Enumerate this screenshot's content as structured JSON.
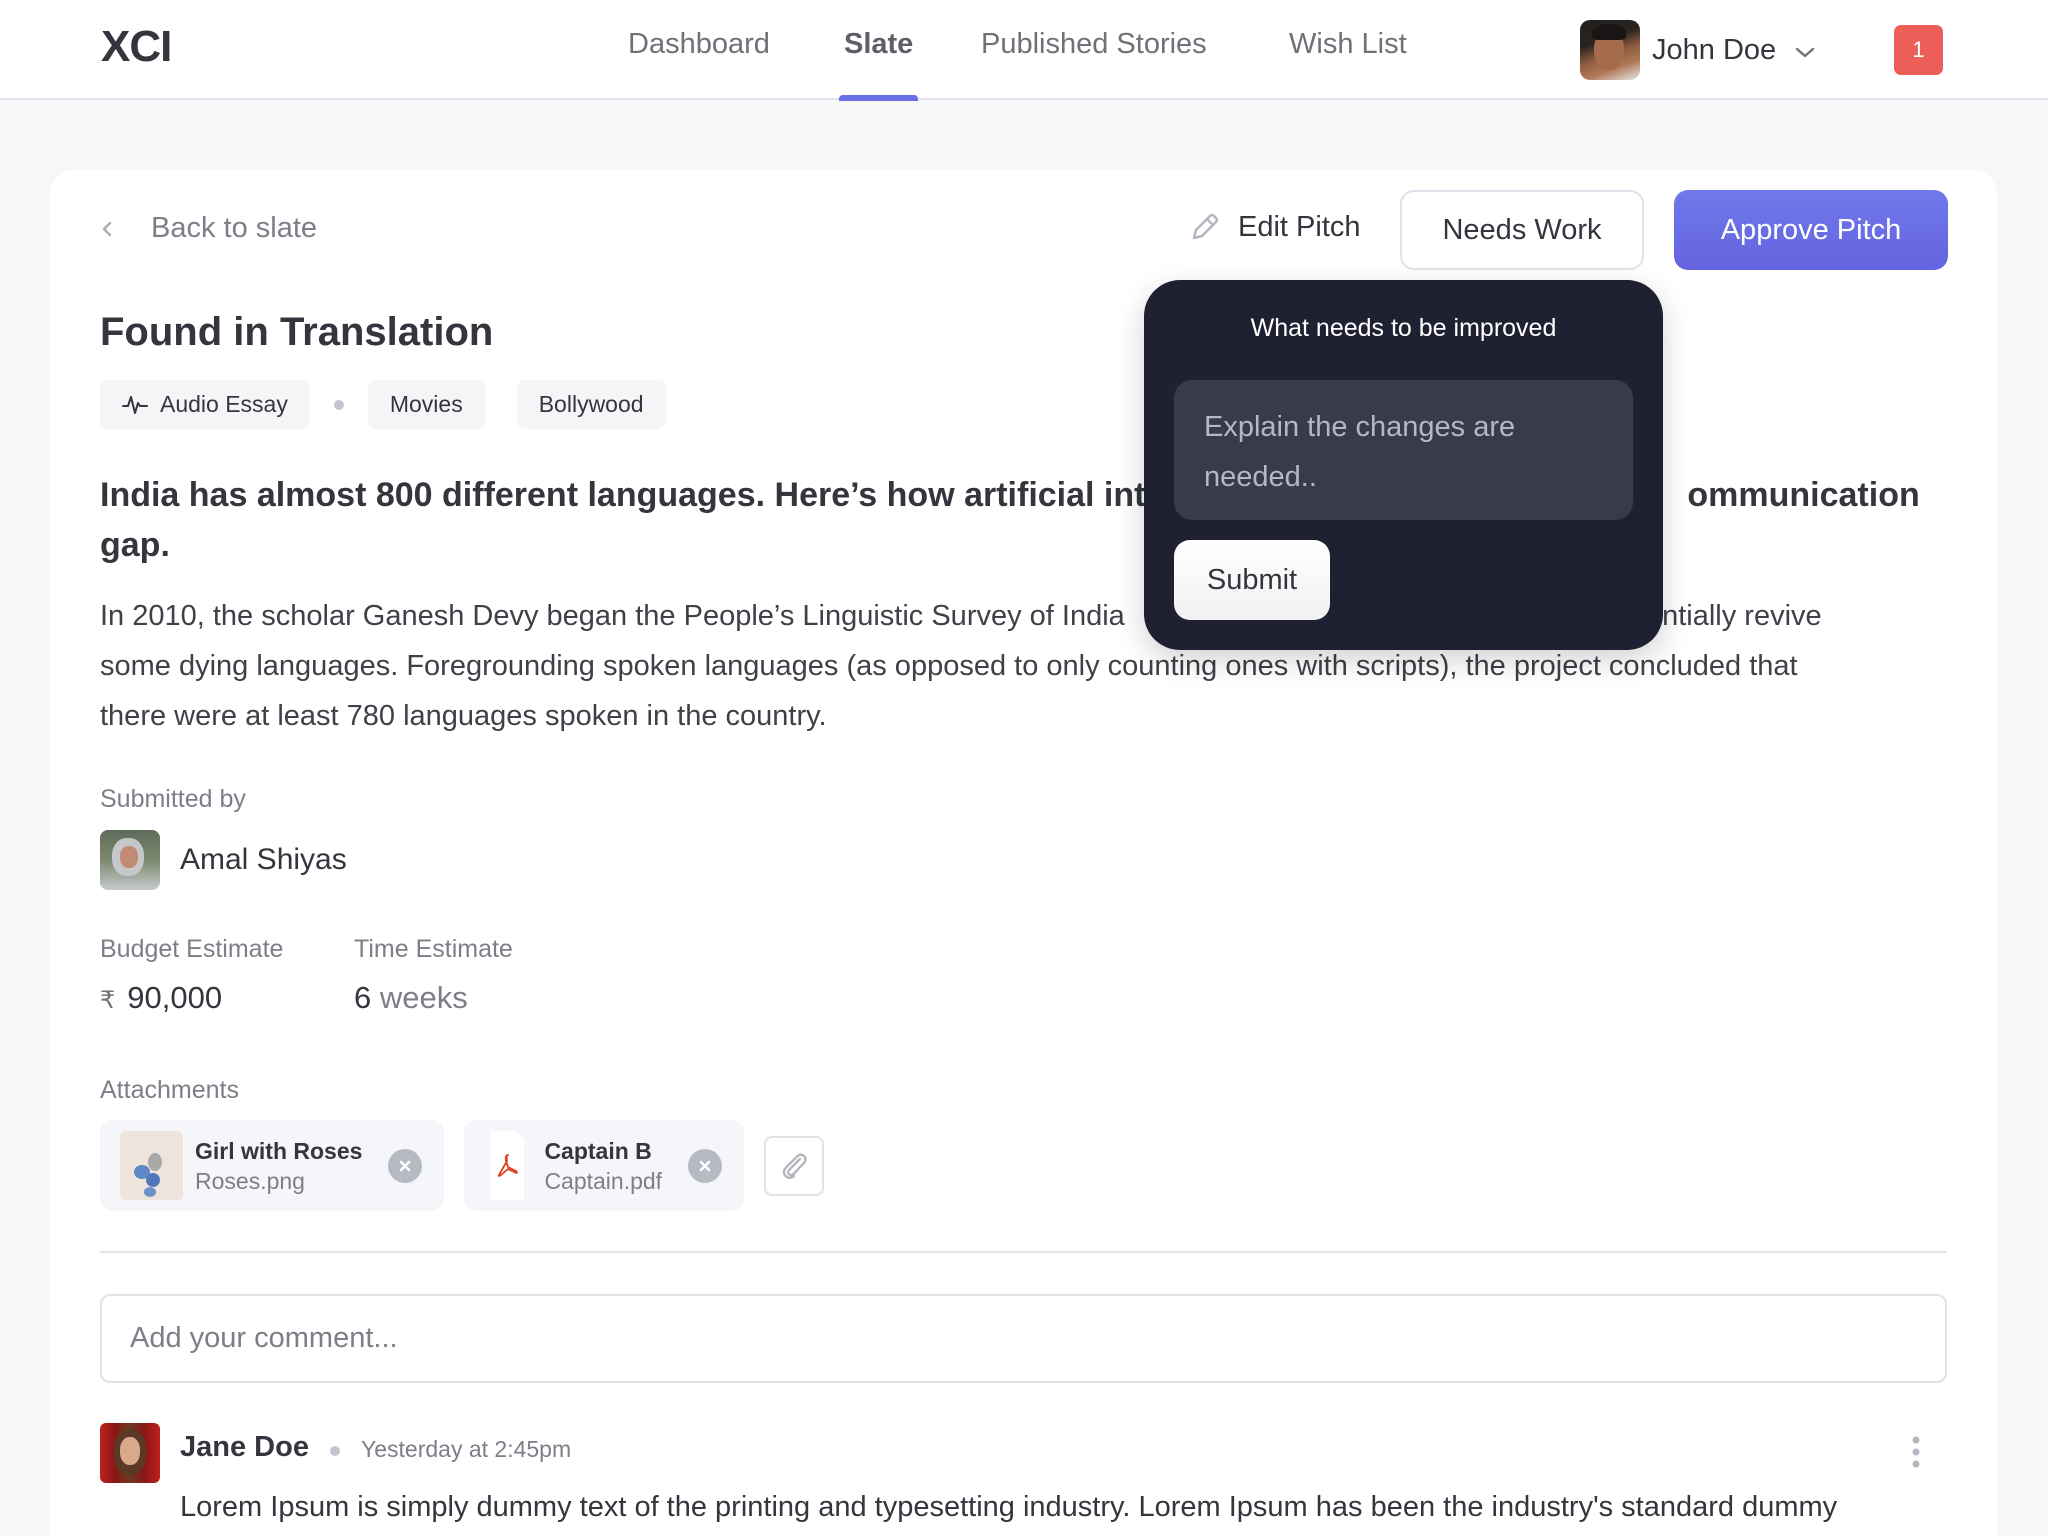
{
  "app": {
    "logo": "XCI"
  },
  "nav": {
    "tabs": [
      {
        "label": "Dashboard",
        "active": false
      },
      {
        "label": "Slate",
        "active": true
      },
      {
        "label": "Published Stories",
        "active": false
      },
      {
        "label": "Wish List",
        "active": false
      }
    ],
    "user": {
      "name": "John Doe",
      "avatar_icon": "user-avatar-photo"
    },
    "notifications": {
      "count": "1",
      "color": "#ec5f59"
    },
    "accent_color": "#6b6fe6"
  },
  "header": {
    "back_label": "Back to slate",
    "edit_label": "Edit Pitch",
    "needs_work_label": "Needs Work",
    "approve_label": "Approve Pitch"
  },
  "pitch": {
    "title": "Found in Translation",
    "format_tag": {
      "label": "Audio Essay",
      "icon": "audio-wave-icon"
    },
    "tags": [
      "Movies",
      "Bollywood"
    ],
    "headline": "India has almost 800 different languages. Here’s how artificial inte",
    "headline_end": "ommunication gap.",
    "body_visible_start": "In 2010, the scholar Ganesh Devy began the People’s Linguistic Survey of India",
    "body_line1_end": "otentially revive",
    "body_line2": "some dying languages. Foregrounding spoken languages (as opposed to only counting ones with scripts), the project concluded that",
    "body_line3": "there were at least 780 languages spoken in the country.",
    "submitted_by_label": "Submitted by",
    "submitter": "Amal Shiyas",
    "budget_label": "Budget Estimate",
    "budget_currency": "₹",
    "budget_value": "90,000",
    "time_label": "Time Estimate",
    "time_value": "6",
    "time_unit": "weeks",
    "attachments_label": "Attachments",
    "attachments": [
      {
        "name": "Girl with Roses",
        "file": "Roses.png",
        "type": "image"
      },
      {
        "name": "Captain B",
        "file": "Captain.pdf",
        "type": "pdf"
      }
    ]
  },
  "comments": {
    "placeholder": "Add your comment...",
    "items": [
      {
        "author": "Jane Doe",
        "time": "Yesterday at 2:45pm",
        "text": "Lorem Ipsum is simply dummy text of the printing and typesetting industry. Lorem Ipsum has been the industry's standard dummy"
      }
    ]
  },
  "popover": {
    "title": "What needs to be improved",
    "placeholder": "Explain the changes are needed..",
    "value": "",
    "submit_label": "Submit"
  }
}
